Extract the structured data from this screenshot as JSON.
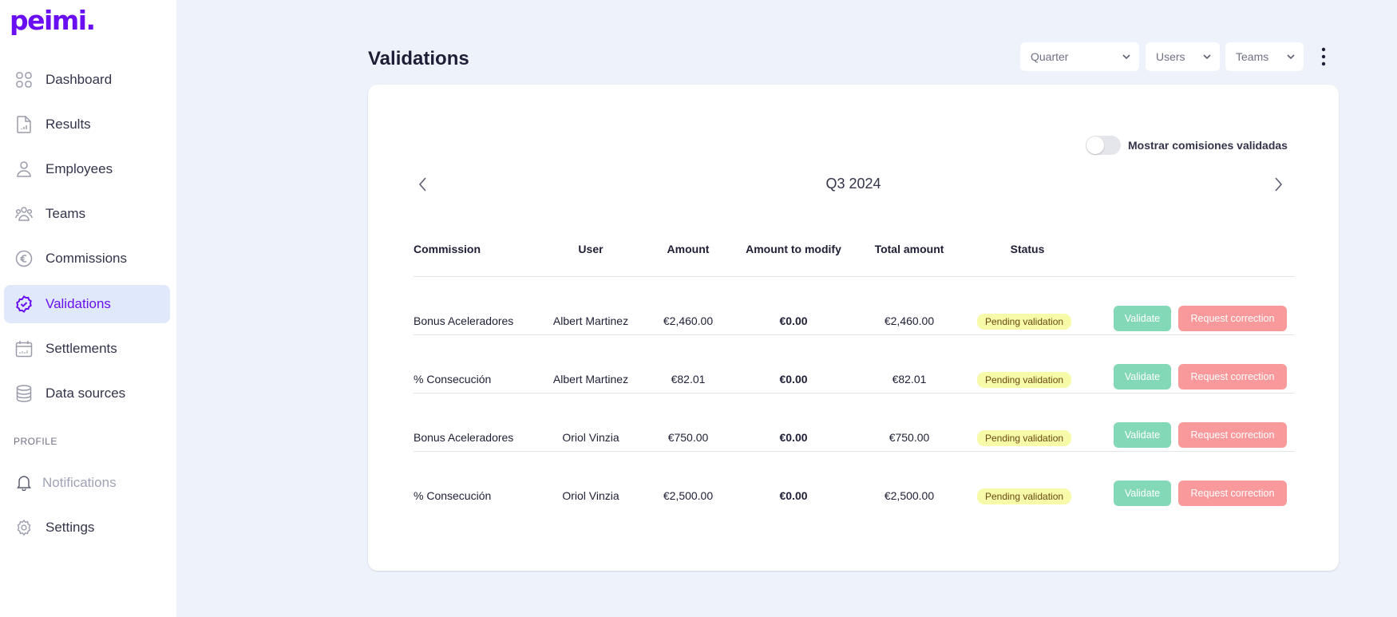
{
  "app": {
    "logo": "peimi."
  },
  "sidebar": {
    "items": [
      {
        "id": "dashboard",
        "label": "Dashboard",
        "icon": "grid-icon"
      },
      {
        "id": "results",
        "label": "Results",
        "icon": "file-chart-icon"
      },
      {
        "id": "employees",
        "label": "Employees",
        "icon": "user-icon"
      },
      {
        "id": "teams",
        "label": "Teams",
        "icon": "users-icon"
      },
      {
        "id": "commissions",
        "label": "Commissions",
        "icon": "euro-icon"
      },
      {
        "id": "validations",
        "label": "Validations",
        "icon": "badge-check-icon",
        "active": true
      },
      {
        "id": "settlements",
        "label": "Settlements",
        "icon": "calendar-icon"
      },
      {
        "id": "data-sources",
        "label": "Data sources",
        "icon": "database-icon"
      }
    ],
    "profile_section": "PROFILE",
    "profile_items": [
      {
        "id": "notifications",
        "label": "Notifications",
        "icon": "bell-icon",
        "disabled": true
      },
      {
        "id": "settings",
        "label": "Settings",
        "icon": "gear-icon"
      }
    ]
  },
  "header": {
    "title": "Validations",
    "filters": [
      {
        "label": "Quarter"
      },
      {
        "label": "Users"
      },
      {
        "label": "Teams"
      }
    ]
  },
  "card": {
    "toggle": {
      "label": "Mostrar comisiones validadas",
      "on": false
    },
    "period": "Q3 2024",
    "columns": [
      "Commission",
      "User",
      "Amount",
      "Amount to modify",
      "Total amount",
      "Status"
    ],
    "rows": [
      {
        "commission": "Bonus Aceleradores",
        "user": "Albert Martinez",
        "amount": "€2,460.00",
        "amount_to_modify": "€0.00",
        "total": "€2,460.00",
        "status": "Pending validation"
      },
      {
        "commission": "% Consecución",
        "user": "Albert Martinez",
        "amount": "€82.01",
        "amount_to_modify": "€0.00",
        "total": "€82.01",
        "status": "Pending validation"
      },
      {
        "commission": "Bonus Aceleradores",
        "user": "Oriol Vinzia",
        "amount": "€750.00",
        "amount_to_modify": "€0.00",
        "total": "€750.00",
        "status": "Pending validation"
      },
      {
        "commission": "% Consecución",
        "user": "Oriol Vinzia",
        "amount": "€2,500.00",
        "amount_to_modify": "€0.00",
        "total": "€2,500.00",
        "status": "Pending validation"
      }
    ],
    "actions": {
      "validate": "Validate",
      "request_correction": "Request correction"
    }
  },
  "colors": {
    "brand": "#6a0ff2",
    "active_bg": "#dfe9fb",
    "validate": "#83d8b7",
    "correction": "#fa999c",
    "pending_bg": "#f6faa9"
  }
}
